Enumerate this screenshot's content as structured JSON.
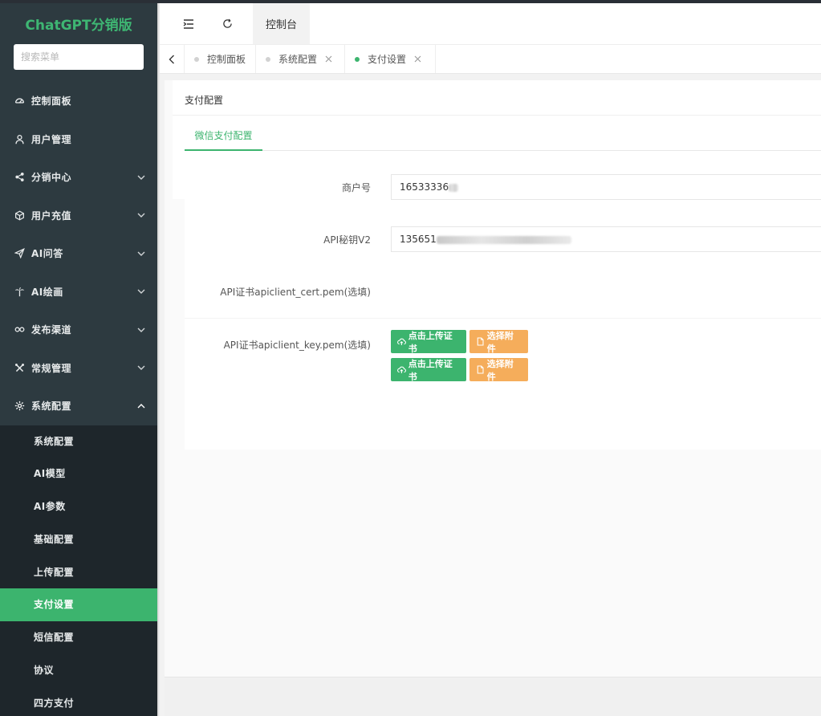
{
  "app": {
    "title": "ChatGPT分销版"
  },
  "sidebar": {
    "search_placeholder": "搜索菜单",
    "items": [
      {
        "label": "控制面板",
        "icon": "dashboard-icon"
      },
      {
        "label": "用户管理",
        "icon": "user-icon"
      },
      {
        "label": "分销中心",
        "icon": "share-icon",
        "expandable": true
      },
      {
        "label": "用户充值",
        "icon": "cube-icon",
        "expandable": true
      },
      {
        "label": "AI问答",
        "icon": "send-icon",
        "expandable": true
      },
      {
        "label": "AI绘画",
        "icon": "palm-icon",
        "expandable": true
      },
      {
        "label": "发布渠道",
        "icon": "link-icon",
        "expandable": true
      },
      {
        "label": "常规管理",
        "icon": "tools-icon",
        "expandable": true
      },
      {
        "label": "系统配置",
        "icon": "gear-icon",
        "expanded": true
      }
    ],
    "sub_items": [
      {
        "label": "系统配置"
      },
      {
        "label": "AI模型"
      },
      {
        "label": "AI参数"
      },
      {
        "label": "基础配置"
      },
      {
        "label": "上传配置"
      },
      {
        "label": "支付设置",
        "active": true
      },
      {
        "label": "短信配置"
      },
      {
        "label": "协议"
      },
      {
        "label": "四方支付"
      }
    ]
  },
  "header": {
    "tab_label": "控制台"
  },
  "tabbar": {
    "tabs": [
      {
        "label": "控制面板",
        "closable": false
      },
      {
        "label": "系统配置",
        "closable": true
      },
      {
        "label": "支付设置",
        "closable": true,
        "active": true
      }
    ]
  },
  "panel": {
    "title": "支付配置",
    "subtab": "微信支付配置"
  },
  "form": {
    "merchant_label": "商户号",
    "merchant_value": "16533336",
    "apikey_label": "API秘钥V2",
    "apikey_value": "135651",
    "cert_label": "API证书apiclient_cert.pem(选填)",
    "key_label": "API证书apiclient_key.pem(选填)",
    "upload_label": "点击上传证书",
    "select_label": "选择附件"
  },
  "colors": {
    "accent": "#3cb46e",
    "sidebar": "#2d3a40",
    "orange": "#f5ad5b"
  }
}
